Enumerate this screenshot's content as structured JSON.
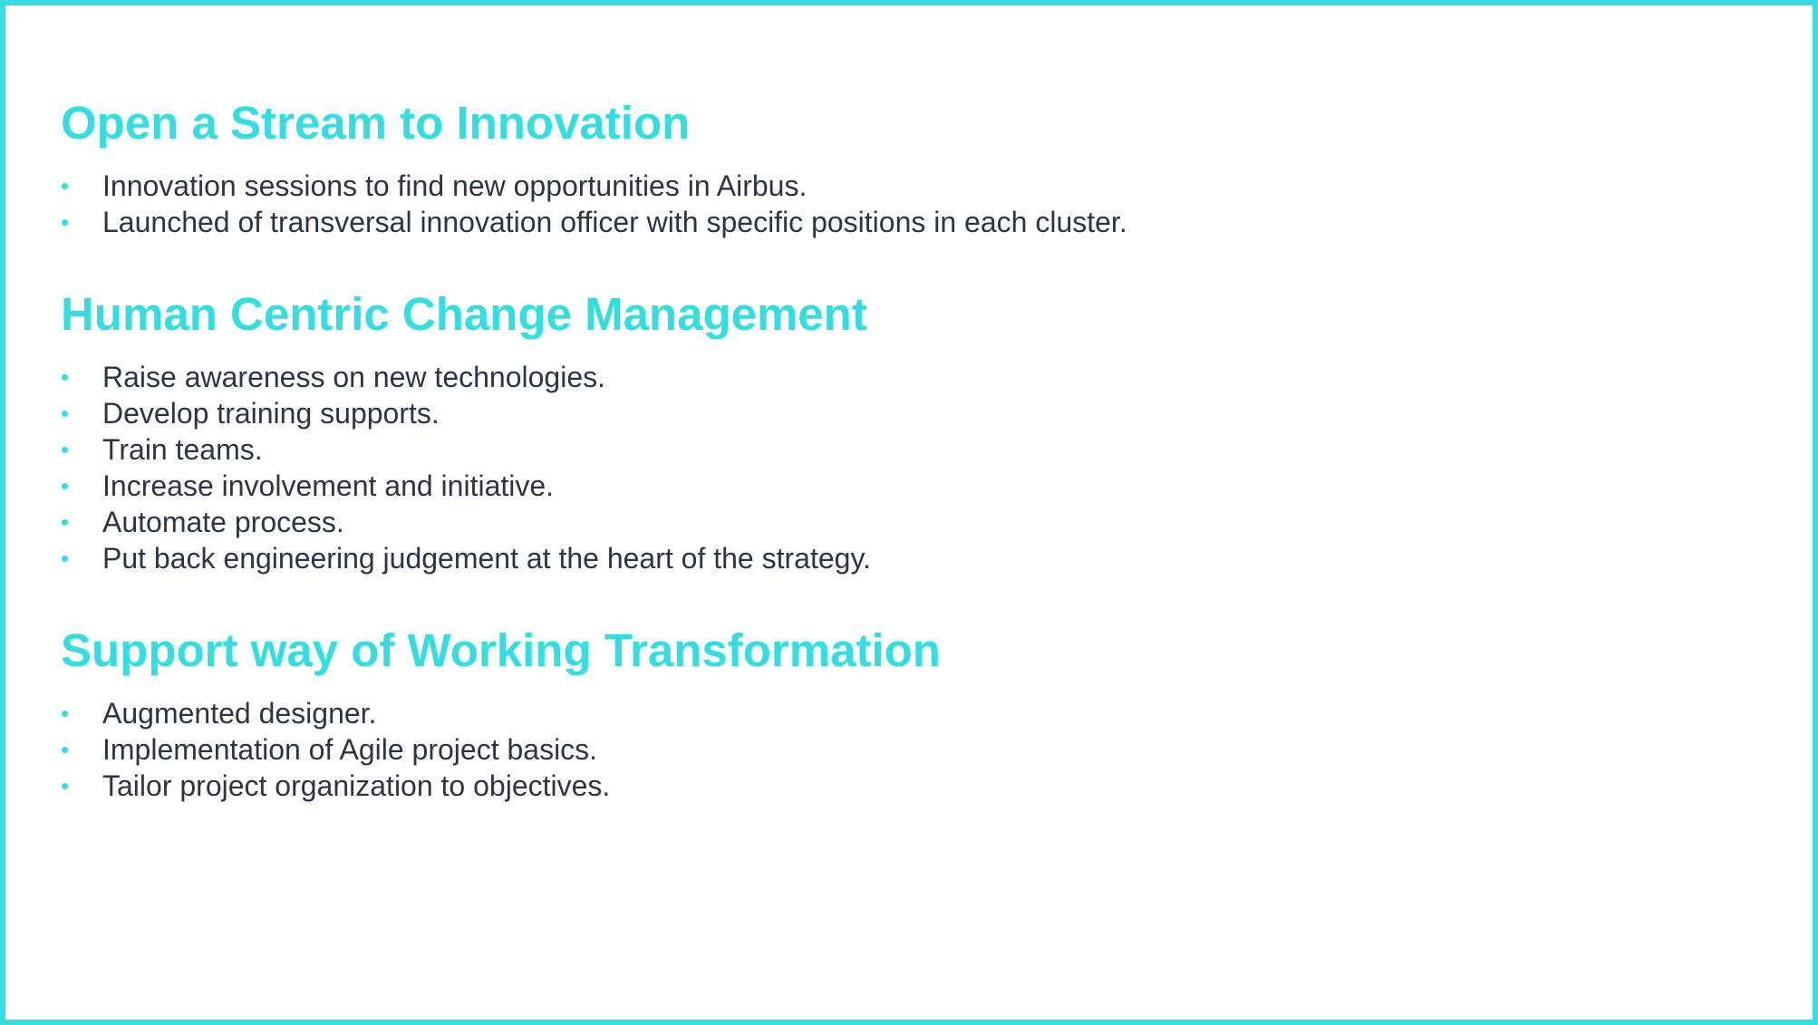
{
  "accent_color": "#33dde0",
  "text_color": "#2d3445",
  "sections": [
    {
      "heading": "Open a Stream to Innovation",
      "bullets": [
        "Innovation sessions to find new opportunities in Airbus.",
        "Launched of transversal innovation officer with specific positions in each cluster."
      ]
    },
    {
      "heading": "Human Centric Change Management",
      "bullets": [
        "Raise awareness on new technologies.",
        "Develop training supports.",
        "Train teams.",
        "Increase involvement and initiative.",
        "Automate process.",
        "Put back engineering judgement at the heart of the strategy."
      ]
    },
    {
      "heading": "Support way of Working Transformation",
      "bullets": [
        "Augmented designer.",
        "Implementation of Agile project basics.",
        "Tailor project organization to objectives."
      ]
    }
  ],
  "bullet_glyph": "•"
}
